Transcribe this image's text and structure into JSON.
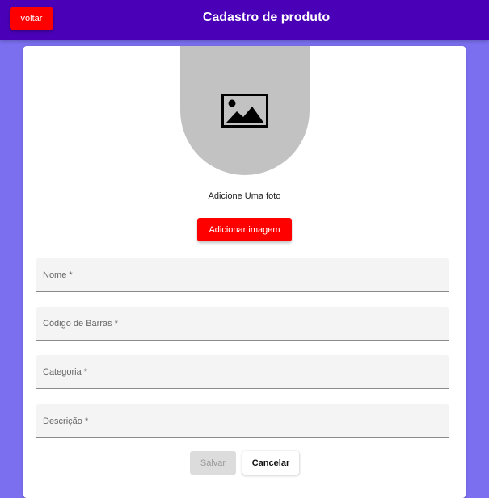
{
  "header": {
    "title": "Cadastro de produto",
    "back_label": "voltar",
    "background_color": "#4a00b7"
  },
  "photo": {
    "icon": "image-icon",
    "caption": "Adicione Uma foto",
    "add_label": "Adicionar imagem"
  },
  "form": {
    "fields": [
      {
        "label": "Nome *",
        "value": ""
      },
      {
        "label": "Código de Barras *",
        "value": ""
      },
      {
        "label": "Categoria *",
        "value": ""
      },
      {
        "label": "Descrição *",
        "value": ""
      }
    ],
    "save_label": "Salvar",
    "cancel_label": "Cancelar"
  },
  "colors": {
    "page_background": "#7b6ff0",
    "accent_button": "#ff0000"
  }
}
